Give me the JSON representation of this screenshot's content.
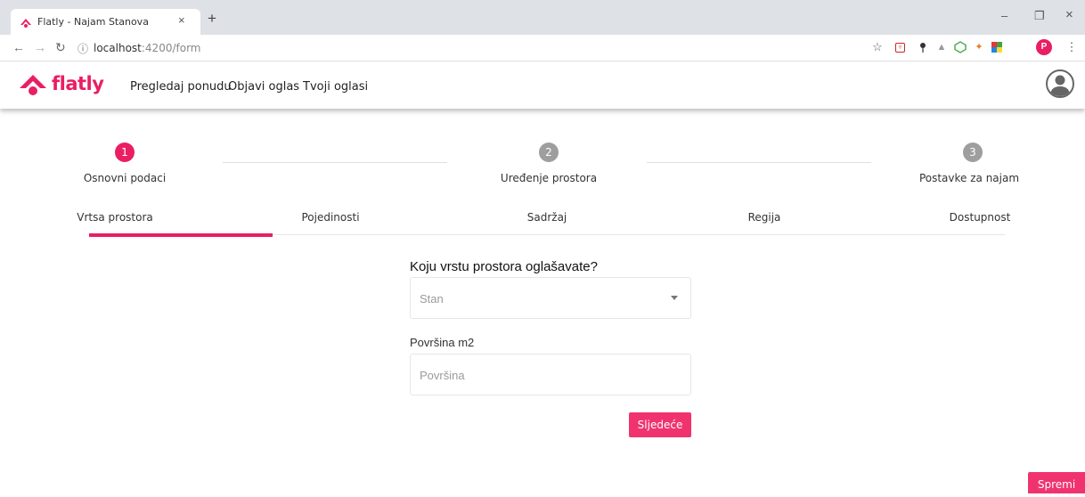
{
  "browser": {
    "tab_title": "Flatly - Najam Stanova",
    "tab_close": "×",
    "new_tab": "+",
    "url_host": "localhost",
    "url_rest": ":4200/form",
    "window_controls": {
      "minimize": "–",
      "restore": "❐",
      "close": "×"
    }
  },
  "app": {
    "brand": "flatly",
    "brand_color": "#e91e63",
    "nav": [
      {
        "label": "Pregledaj ponudu"
      },
      {
        "label": "Objavi oglas"
      },
      {
        "label": "Tvoji oglasi"
      }
    ]
  },
  "stepper": [
    {
      "number": "1",
      "label": "Osnovni podaci",
      "active": true
    },
    {
      "number": "2",
      "label": "Uređenje prostora",
      "active": false
    },
    {
      "number": "3",
      "label": "Postavke za najam",
      "active": false
    }
  ],
  "subtabs": [
    {
      "label": "Vrtsa prostora",
      "active": true
    },
    {
      "label": "Pojedinosti"
    },
    {
      "label": "Sadržaj"
    },
    {
      "label": "Regija"
    },
    {
      "label": "Dostupnost"
    }
  ],
  "form": {
    "question": "Koju vrstu prostora oglašavate?",
    "type_select_value": "Stan",
    "area_label": "Površina m2",
    "area_placeholder": "Površina",
    "next_button": "Sljedeće",
    "save_button": "Spremi"
  }
}
